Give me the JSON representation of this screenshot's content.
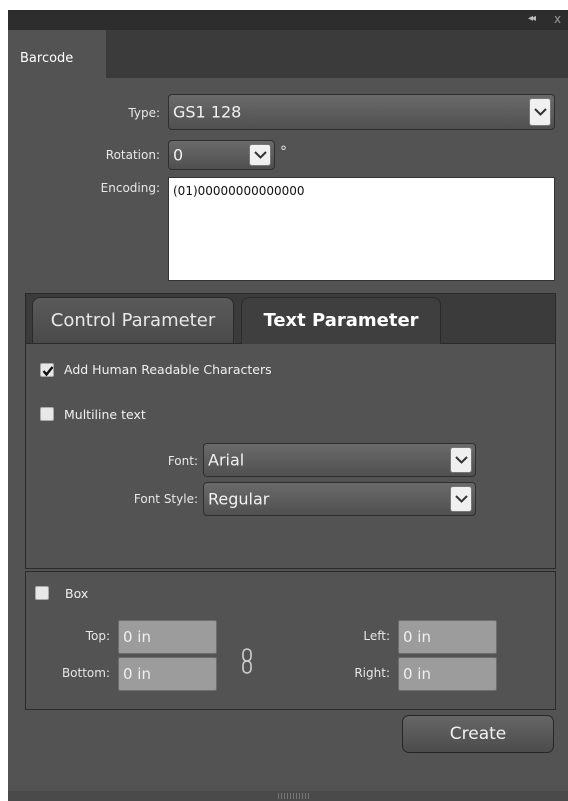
{
  "window": {
    "collapse_icon": "double-chevron-left-icon",
    "close_label": "x"
  },
  "tabs": {
    "barcode": "Barcode"
  },
  "form": {
    "type_label": "Type:",
    "type_value": "GS1 128",
    "rotation_label": "Rotation:",
    "rotation_value": "0",
    "degree_symbol": "°",
    "encoding_label": "Encoding:",
    "encoding_value": "(01)00000000000000"
  },
  "param_tabs": {
    "control": "Control Parameter",
    "text": "Text Parameter",
    "active": "text"
  },
  "text_params": {
    "add_human_readable_label": "Add Human Readable Characters",
    "add_human_readable_checked": true,
    "multiline_label": "Multiline text",
    "multiline_checked": false,
    "font_label": "Font:",
    "font_value": "Arial",
    "font_style_label": "Font Style:",
    "font_style_value": "Regular"
  },
  "box": {
    "label": "Box",
    "checked": false,
    "top_label": "Top:",
    "top_value": "0 in",
    "bottom_label": "Bottom:",
    "bottom_value": "0 in",
    "left_label": "Left:",
    "left_value": "0 in",
    "right_label": "Right:",
    "right_value": "0 in",
    "link_icon": "chain-link-icon"
  },
  "actions": {
    "create_label": "Create"
  },
  "colors": {
    "panel_bg": "#535353",
    "dark_bg": "#3b3b3b",
    "titlebar_bg": "#2d2d2d",
    "field_bg": "#9c9c9c"
  }
}
